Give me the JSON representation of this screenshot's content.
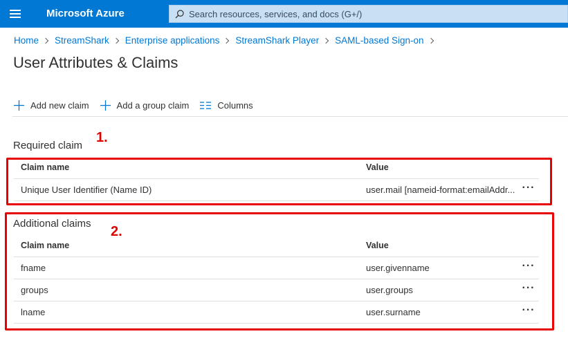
{
  "header": {
    "brand": "Microsoft Azure",
    "search_placeholder": "Search resources, services, and docs (G+/)",
    "color": "#0078d4"
  },
  "breadcrumb": [
    "Home",
    "StreamShark",
    "Enterprise applications",
    "StreamShark Player",
    "SAML-based Sign-on"
  ],
  "page_title": "User Attributes & Claims",
  "toolbar": {
    "add_claim": "Add new claim",
    "add_group_claim": "Add a group claim",
    "columns": "Columns"
  },
  "required": {
    "title": "Required claim",
    "annotation": "1.",
    "col_name": "Claim name",
    "col_value": "Value",
    "rows": [
      {
        "name": "Unique User Identifier (Name ID)",
        "value": "user.mail [nameid-format:emailAddr...",
        "more": "···"
      }
    ]
  },
  "additional": {
    "title": "Additional claims",
    "annotation": "2.",
    "col_name": "Claim name",
    "col_value": "Value",
    "rows": [
      {
        "name": "fname",
        "value": "user.givenname",
        "more": "···"
      },
      {
        "name": "groups",
        "value": "user.groups",
        "more": "···"
      },
      {
        "name": "lname",
        "value": "user.surname",
        "more": "···"
      }
    ]
  },
  "icons": [
    "hamburger-icon",
    "search-icon",
    "plus-icon",
    "columns-icon",
    "more-icon"
  ],
  "annotation_color": "#e60000"
}
